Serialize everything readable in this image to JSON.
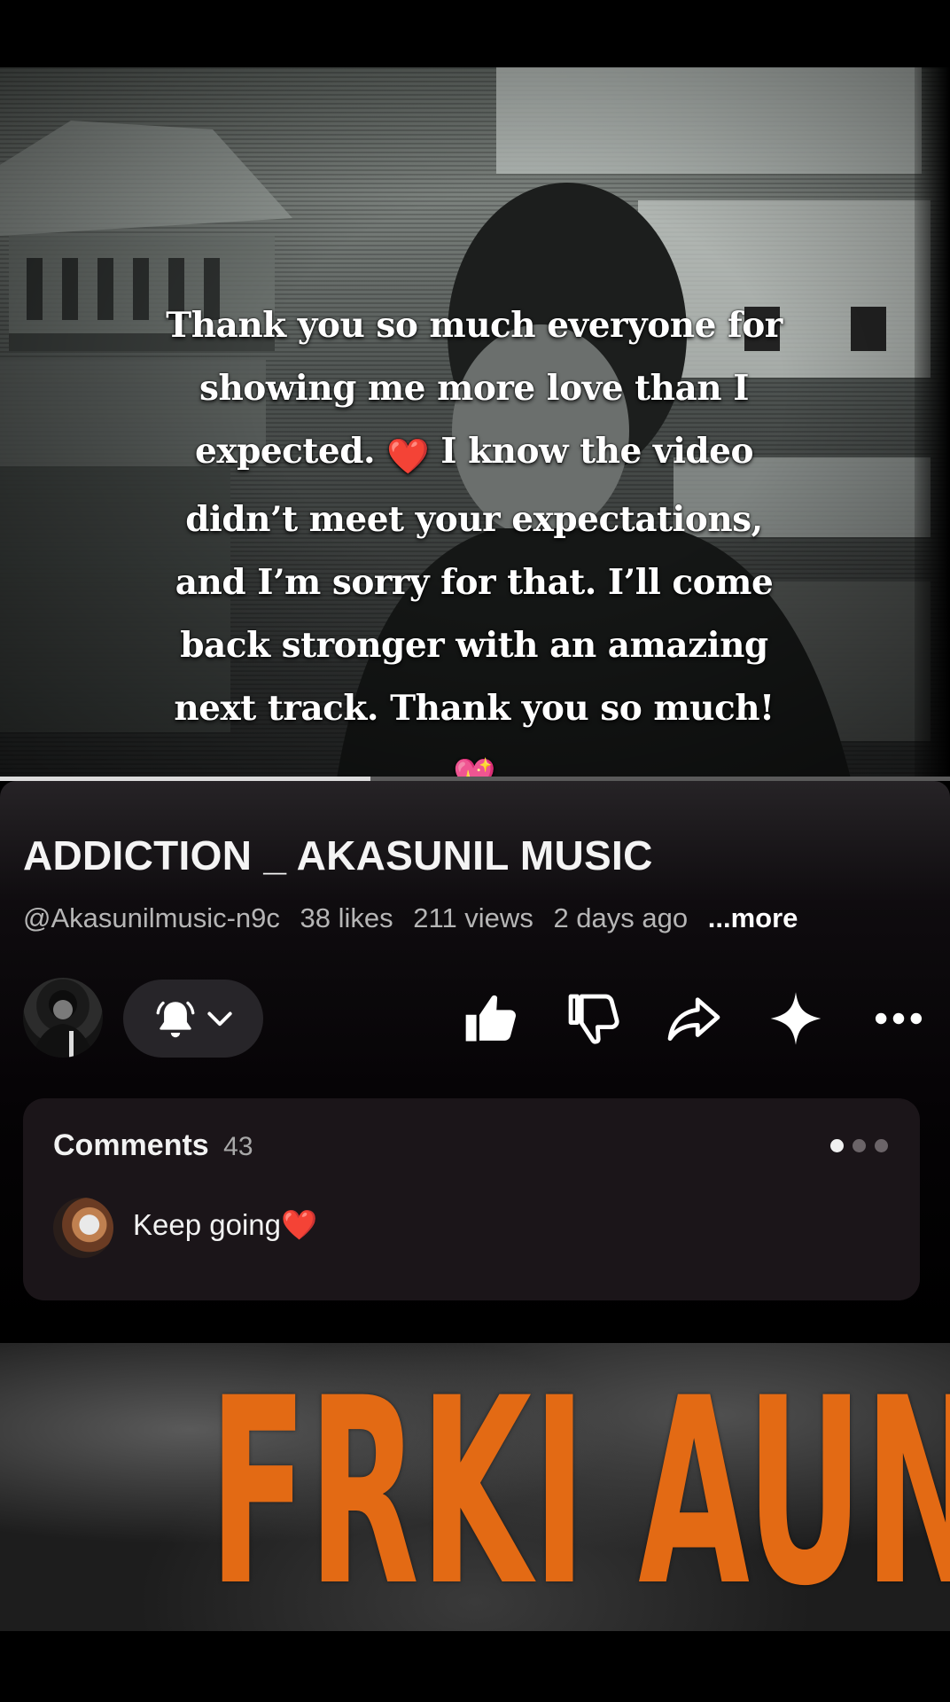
{
  "video": {
    "caption": "Thank you so much everyone for showing me more love than I expected.",
    "caption_emoji1": "❤️",
    "caption_mid": "I know the video didn’t meet your expectations, and I’m sorry for that. I’ll come back stronger with an amazing next track. Thank you so much!",
    "caption_emoji2": "💖",
    "progress": 0.39
  },
  "info": {
    "title": "ADDICTION _ AKASUNIL MUSIC",
    "channel": "@Akasunilmusic-n9c",
    "likes": "38 likes",
    "views": "211 views",
    "age": "2 days ago",
    "more": "...more"
  },
  "actions": {
    "icons": [
      "bell-icon",
      "chevron-down-icon",
      "like-icon",
      "dislike-icon",
      "share-icon",
      "remix-icon",
      "more-icon"
    ]
  },
  "comments": {
    "label": "Comments",
    "count": "43",
    "top_comment": "Keep going❤️"
  },
  "next_video": {
    "thumbnail_text": "FRKI AUN"
  },
  "colors": {
    "background": "#000000",
    "panel": "#0f0c0f",
    "card": "#1b1519",
    "accent_orange": "#e36a14"
  }
}
